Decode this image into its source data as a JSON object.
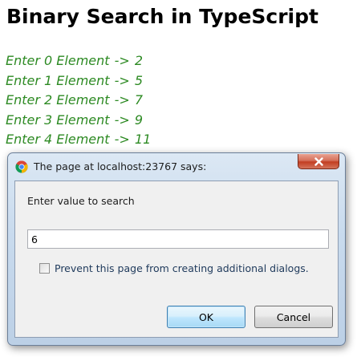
{
  "page": {
    "title": "Binary Search in TypeScript",
    "elements": [
      {
        "prefix": "Enter 0 Element",
        "arrow": "->",
        "value": "2"
      },
      {
        "prefix": "Enter 1 Element",
        "arrow": "->",
        "value": "5"
      },
      {
        "prefix": "Enter 2 Element",
        "arrow": "->",
        "value": "7"
      },
      {
        "prefix": "Enter 3 Element",
        "arrow": "->",
        "value": "9"
      },
      {
        "prefix": "Enter 4 Element",
        "arrow": "->",
        "value": "11"
      }
    ],
    "element_color": "#2d8a23"
  },
  "dialog": {
    "title": "The page at localhost:23767 says:",
    "icon": "chrome-icon",
    "close_icon": "close-icon",
    "prompt": "Enter value to search",
    "input_value": "6",
    "prevent_label": "Prevent this page from creating additional dialogs.",
    "prevent_checked": false,
    "ok_label": "OK",
    "cancel_label": "Cancel",
    "close_color": "#c94a2e"
  }
}
